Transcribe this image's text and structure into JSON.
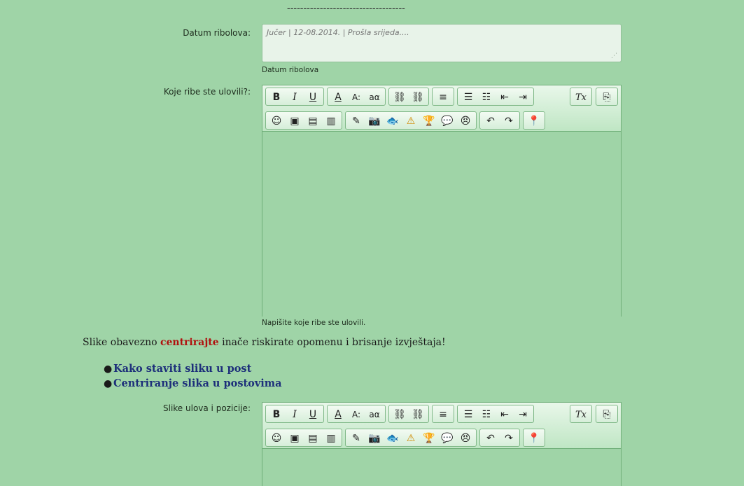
{
  "separator": "------------------------------------",
  "date_field": {
    "label": "Datum ribolova:",
    "placeholder": "Jučer | 12-08.2014. | Prošla srijeda....",
    "hint": "Datum ribolova"
  },
  "fish_field": {
    "label": "Koje ribe ste ulovili?:",
    "hint": "Napišite koje ribe ste ulovili."
  },
  "notice": {
    "before": "Slike obavezno ",
    "highlight": "centrirajte",
    "after": " inače riskirate opomenu i brisanje izvještaja!"
  },
  "help_links": [
    "Kako staviti sliku u post",
    "Centriranje slika u postovima"
  ],
  "images_field": {
    "label": "Slike ulova i pozicije:"
  },
  "toolbar": {
    "bold": "B",
    "italic": "I",
    "underline": "U",
    "font_color": "A",
    "font_size": "A:",
    "font_family": "aα",
    "link": "⛓",
    "unlink": "⛓",
    "align": "≡",
    "bullet_list": "☰",
    "numbered_list": "☷",
    "outdent": "⇤",
    "indent": "⇥",
    "remove_format": "Tx",
    "source": "⎘",
    "smiley": "☺",
    "image": "▣",
    "gallery": "▤",
    "template": "▥",
    "spoiler": "✎",
    "camera": "📷",
    "fish": "🐟",
    "warning": "⚠",
    "trophy": "🏆",
    "chat": "💬",
    "emoji": "😠",
    "undo": "↶",
    "redo": "↷",
    "location": "📍"
  }
}
